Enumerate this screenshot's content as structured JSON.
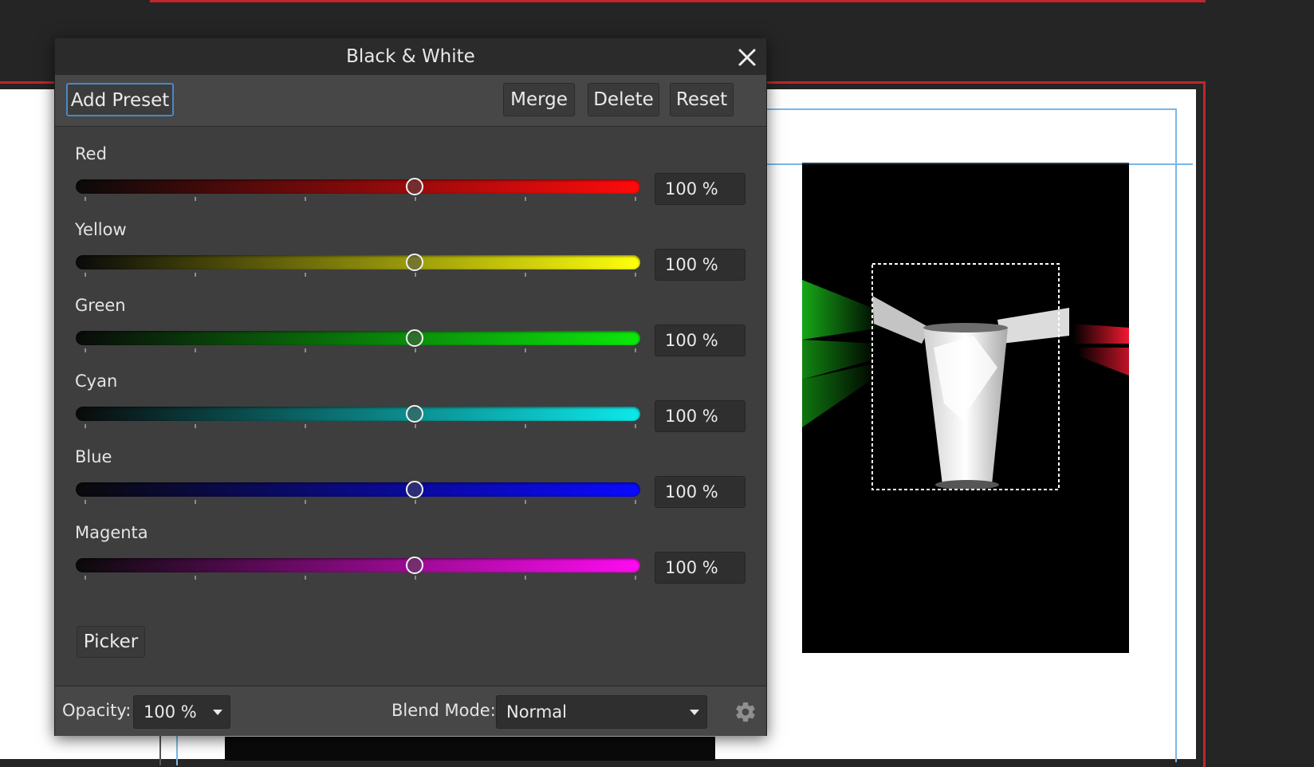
{
  "dialog": {
    "title": "Black & White",
    "close_icon": "close-icon",
    "toolbar": {
      "add_preset": "Add Preset",
      "merge": "Merge",
      "delete": "Delete",
      "reset": "Reset"
    },
    "sliders": [
      {
        "label": "Red",
        "value": "100 %",
        "level": 0.6,
        "colors": [
          "#0a0a0a",
          "#ff0b0b"
        ]
      },
      {
        "label": "Yellow",
        "value": "100 %",
        "level": 0.6,
        "colors": [
          "#0a0a0a",
          "#ffff0d"
        ]
      },
      {
        "label": "Green",
        "value": "100 %",
        "level": 0.6,
        "colors": [
          "#0a0a0a",
          "#0be80b"
        ]
      },
      {
        "label": "Cyan",
        "value": "100 %",
        "level": 0.6,
        "colors": [
          "#0a0a0a",
          "#0de8ea"
        ]
      },
      {
        "label": "Blue",
        "value": "100 %",
        "level": 0.6,
        "colors": [
          "#0a0a0a",
          "#0a0aff"
        ]
      },
      {
        "label": "Magenta",
        "value": "100 %",
        "level": 0.6,
        "colors": [
          "#0a0a0a",
          "#ff0bf2"
        ]
      }
    ],
    "picker": "Picker",
    "footer": {
      "opacity_label": "Opacity:",
      "opacity_value": "100 %",
      "blend_label": "Blend Mode:",
      "blend_value": "Normal",
      "settings_icon": "gear-icon"
    }
  },
  "colors": {
    "accent": "#4c86c8",
    "guide": "#7ab8e6",
    "frame_red": "#c0262c"
  }
}
